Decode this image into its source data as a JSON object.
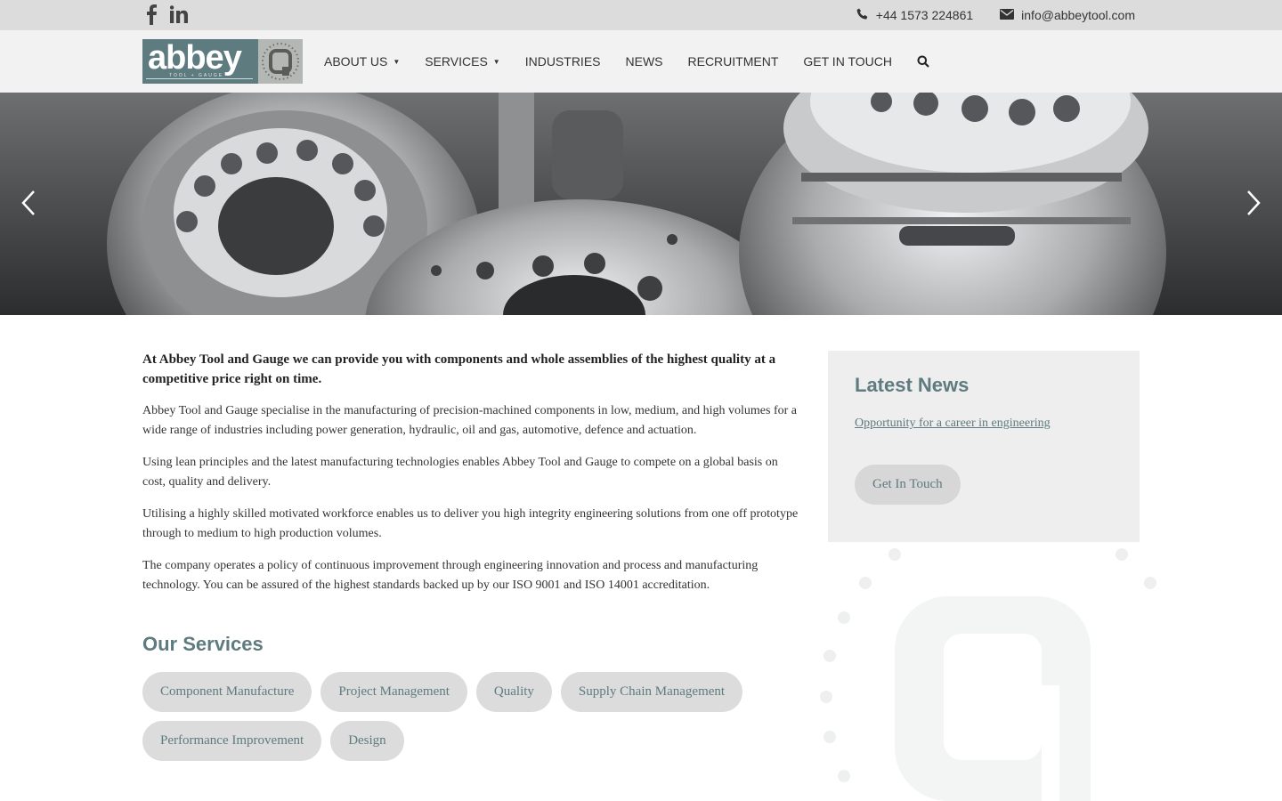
{
  "topbar": {
    "social": [
      {
        "icon": "facebook-icon"
      },
      {
        "icon": "linkedin-icon"
      }
    ],
    "phone": "+44 1573 224861",
    "email": "info@abbeytool.com"
  },
  "header": {
    "logo": {
      "word": "abbey",
      "sub": "TOOL + GAUGE"
    },
    "nav": [
      {
        "label": "ABOUT US",
        "caret": "▼"
      },
      {
        "label": "SERVICES",
        "caret": "▼"
      },
      {
        "label": "INDUSTRIES"
      },
      {
        "label": "NEWS"
      },
      {
        "label": "RECRUITMENT"
      },
      {
        "label": "GET IN TOUCH"
      }
    ]
  },
  "content": {
    "intro": "At Abbey Tool and Gauge we can provide you with components and whole assemblies of the highest quality at a competitive price right on time.",
    "paragraphs": [
      "Abbey Tool and Gauge specialise in the manufacturing of precision-machined components in low, medium, and high volumes for a wide range of industries including power generation, hydraulic, oil and gas, automotive, defence and  actuation.",
      "Using lean principles and the latest manufacturing technologies enables Abbey Tool and Gauge to compete on a global basis on cost, quality and delivery.",
      "Utilising a highly skilled motivated workforce enables us to deliver you high integrity engineering solutions from one off prototype through to medium to high production volumes.",
      "The company operates a policy of continuous improvement through engineering innovation and process and manufacturing technology.  You can be assured of the highest standards backed up by our ISO 9001 and ISO 14001 accreditation."
    ],
    "services_title": "Our Services",
    "services": [
      "Component Manufacture",
      "Project Management",
      "Quality",
      "Supply Chain Management",
      "Performance Improvement",
      "Design"
    ]
  },
  "sidebar": {
    "title": "Latest News",
    "link": "Opportunity for a career in engineering",
    "button": "Get In Touch"
  },
  "colors": {
    "accent": "#5e7b7f",
    "pill_bg": "#dcdcdc",
    "topbar_bg": "#dcdcdc",
    "header_bg": "#f2f2f2"
  }
}
